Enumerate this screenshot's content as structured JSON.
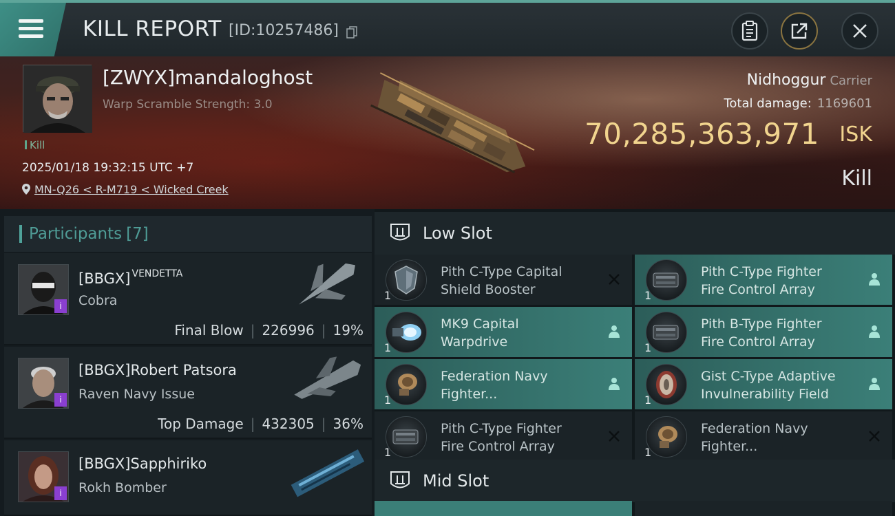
{
  "header": {
    "title": "KILL REPORT",
    "report_id": "[ID:10257486]"
  },
  "victim": {
    "name": "[ZWYX]mandaloghost",
    "warp_scramble": "Warp Scramble Strength:  3.0",
    "kill_tag": "Kill",
    "datetime": "2025/01/18 19:32:15 UTC +7",
    "location": "MN-Q26 < R-M719 < Wicked Creek",
    "ship_name": "Nidhoggur",
    "ship_class": "Carrier",
    "total_damage_label": "Total damage:",
    "total_damage_value": "1169601",
    "isk_value": "70,285,363,971",
    "isk_unit": "ISK",
    "result": "Kill"
  },
  "participants": {
    "title": "Participants",
    "count": "[7]",
    "rows": [
      {
        "name": "[BBGX]",
        "title_sup": "VENDETTA",
        "ship": "Cobra",
        "role": "Final Blow",
        "damage": "226996",
        "percent": "19%",
        "badge": "i"
      },
      {
        "name": "[BBGX]Robert Patsora",
        "title_sup": "",
        "ship": "Raven Navy Issue",
        "role": "Top Damage",
        "damage": "432305",
        "percent": "36%",
        "badge": "i"
      },
      {
        "name": "[BBGX]Sapphiriko",
        "title_sup": "",
        "ship": "Rokh Bomber",
        "role": "",
        "damage": "",
        "percent": "",
        "badge": "i"
      }
    ]
  },
  "fitting": {
    "low_slot_title": "Low Slot",
    "mid_slot_title": "Mid Slot",
    "low_slot": [
      {
        "line1": "Pith C-Type Capital",
        "line2": "Shield Booster",
        "qty": "1",
        "status": "destroyed",
        "highlighted": false
      },
      {
        "line1": "Pith C-Type Fighter",
        "line2": "Fire Control Array",
        "qty": "1",
        "status": "dropped",
        "highlighted": true
      },
      {
        "line1": "MK9 Capital",
        "line2": "Warpdrive",
        "qty": "1",
        "status": "dropped",
        "highlighted": true
      },
      {
        "line1": "Pith B-Type Fighter",
        "line2": "Fire Control Array",
        "qty": "1",
        "status": "dropped",
        "highlighted": true
      },
      {
        "line1": "Federation Navy",
        "line2": "Fighter...",
        "qty": "1",
        "status": "dropped",
        "highlighted": true
      },
      {
        "line1": "Gist C-Type Adaptive",
        "line2": "Invulnerability Field",
        "qty": "1",
        "status": "dropped",
        "highlighted": true
      },
      {
        "line1": "Pith C-Type Fighter",
        "line2": "Fire Control Array",
        "qty": "1",
        "status": "destroyed",
        "highlighted": false
      },
      {
        "line1": "Federation Navy",
        "line2": "Fighter...",
        "qty": "1",
        "status": "destroyed",
        "highlighted": false
      }
    ]
  },
  "colors": {
    "accent_teal": "#4fa29a",
    "isk_gold": "#f1d48e",
    "highlight_row": "#3b7f78",
    "badge_purple": "#8a3fd0"
  },
  "icons": [
    "menu-icon",
    "copy-icon",
    "clipboard-icon",
    "share-icon",
    "close-icon",
    "location-pin-icon",
    "slot-icon",
    "person-icon",
    "x-icon"
  ]
}
